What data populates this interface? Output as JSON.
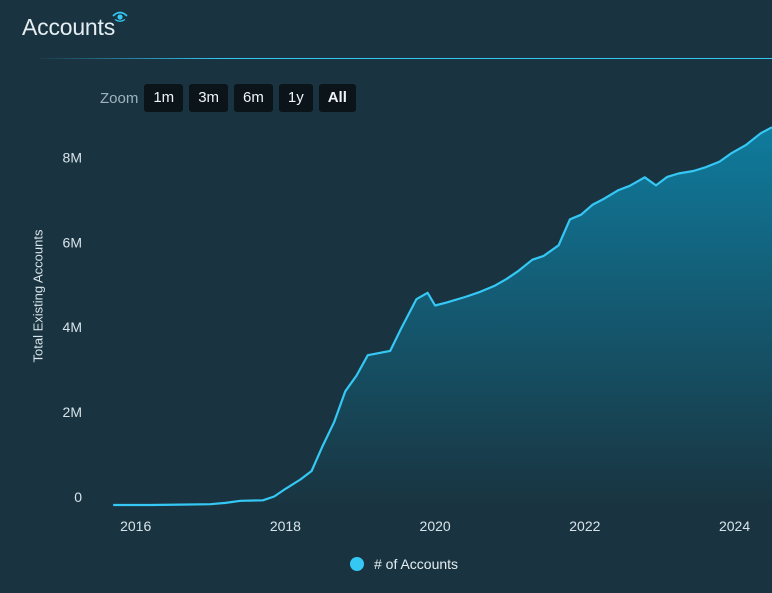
{
  "header": {
    "title": "Accounts",
    "icon": "eye-icon"
  },
  "zoom": {
    "label": "Zoom",
    "buttons": [
      "1m",
      "3m",
      "6m",
      "1y",
      "All"
    ],
    "selected": "All"
  },
  "colors": {
    "background": "#193440",
    "line": "#35c8f5",
    "divider": "#35c8f5"
  },
  "chart_data": {
    "type": "area",
    "ylabel": "Total Existing Accounts",
    "y_ticks": [
      "0",
      "2M",
      "4M",
      "6M",
      "8M"
    ],
    "x_ticks": [
      "2016",
      "2018",
      "2020",
      "2022",
      "2024"
    ],
    "ylim": [
      0,
      8600000
    ],
    "xlim": [
      2015.55,
      2024.5
    ],
    "grid": false,
    "legend_position": "bottom-center",
    "series": [
      {
        "name": "# of Accounts",
        "color": "#35c8f5",
        "x": [
          2015.7,
          2016.2,
          2016.6,
          2017.0,
          2017.2,
          2017.4,
          2017.7,
          2017.85,
          2018.0,
          2018.2,
          2018.35,
          2018.5,
          2018.65,
          2018.8,
          2018.95,
          2019.1,
          2019.4,
          2019.55,
          2019.75,
          2019.9,
          2020.0,
          2020.15,
          2020.4,
          2020.6,
          2020.8,
          2020.95,
          2021.1,
          2021.3,
          2021.45,
          2021.65,
          2021.8,
          2021.95,
          2022.1,
          2022.25,
          2022.45,
          2022.6,
          2022.8,
          2022.95,
          2023.1,
          2023.25,
          2023.45,
          2023.6,
          2023.8,
          2023.95,
          2024.15,
          2024.35,
          2024.5
        ],
        "values": [
          0,
          0,
          10000,
          20000,
          50000,
          100000,
          110000,
          200000,
          380000,
          600000,
          800000,
          1400000,
          1950000,
          2680000,
          3050000,
          3530000,
          3630000,
          4170000,
          4850000,
          5000000,
          4700000,
          4770000,
          4900000,
          5020000,
          5170000,
          5320000,
          5500000,
          5780000,
          5870000,
          6120000,
          6730000,
          6840000,
          7070000,
          7210000,
          7420000,
          7520000,
          7720000,
          7530000,
          7730000,
          7810000,
          7870000,
          7950000,
          8090000,
          8280000,
          8480000,
          8760000,
          8900000
        ]
      }
    ]
  },
  "legend": {
    "label": "# of Accounts"
  }
}
